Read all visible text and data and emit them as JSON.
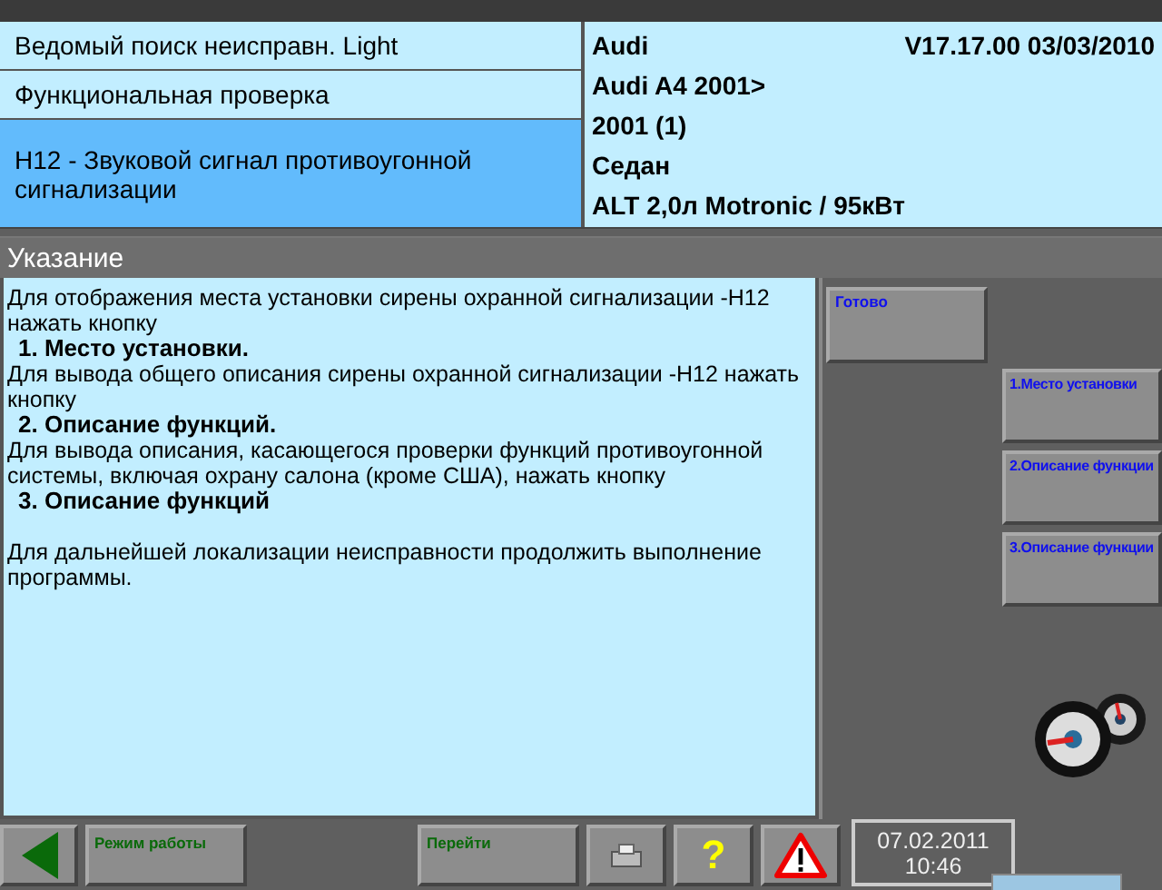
{
  "header": {
    "left": [
      {
        "label": "Ведомый поиск неисправн. Light",
        "selected": false
      },
      {
        "label": "Функциональная проверка",
        "selected": false
      },
      {
        "label": "H12 - Звуковой сигнал противоугонной сигнализации",
        "selected": true
      }
    ],
    "brand": "Audi",
    "version": "V17.17.00 03/03/2010",
    "vehicle": [
      "Audi A4 2001>",
      "2001 (1)",
      "Седан",
      "ALT 2,0л Motronic / 95кВт"
    ]
  },
  "section_title": "Указание",
  "instructions": [
    {
      "kind": "text",
      "text": "Для отображения места установки сирены охранной сигнализации -H12 нажать кнопку"
    },
    {
      "kind": "heading",
      "text": "1. Место установки."
    },
    {
      "kind": "text",
      "text": "Для вывода общего описания сирены охранной сигнализации -H12 нажать кнопку"
    },
    {
      "kind": "heading",
      "text": "2. Описание функций."
    },
    {
      "kind": "text",
      "text": "Для вывода описания, касающегося проверки функций противоугонной системы, включая охрану салона (кроме США), нажать кнопку"
    },
    {
      "kind": "heading",
      "text": "3. Описание функций"
    },
    {
      "kind": "gap"
    },
    {
      "kind": "text",
      "text": "Для дальнейшей локализации неисправности продолжить выполнение программы."
    }
  ],
  "done_button": "Готово",
  "side_buttons": [
    "1.Место установки",
    "2.Описание функции",
    "3.Описание функции"
  ],
  "footer": {
    "mode_button": "Режим работы",
    "goto_button": "Перейти",
    "help_button": "?",
    "date": "07.02.2011",
    "time": "10:46"
  }
}
